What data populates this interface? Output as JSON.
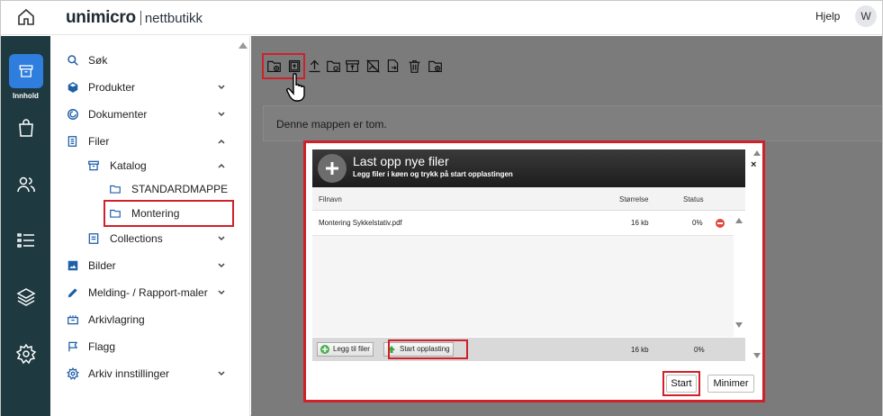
{
  "header": {
    "brand_main": "unimicro",
    "brand_sub": "nettbutikk",
    "help": "Hjelp",
    "avatar_initial": "W"
  },
  "rail": {
    "active_label": "Innhold",
    "icons": [
      "content-icon",
      "bag-icon",
      "users-icon",
      "list-icon",
      "layers-icon",
      "settings-icon"
    ]
  },
  "sidebar": {
    "items": [
      {
        "label": "Søk",
        "icon": "search-icon"
      },
      {
        "label": "Produkter",
        "icon": "box-icon"
      },
      {
        "label": "Dokumenter",
        "icon": "globe-icon"
      },
      {
        "label": "Filer",
        "icon": "files-icon"
      },
      {
        "label": "Katalog",
        "icon": "catalog-icon"
      },
      {
        "label": "STANDARDMAPPE",
        "icon": "folder-icon"
      },
      {
        "label": "Montering",
        "icon": "folder-icon"
      },
      {
        "label": "Collections",
        "icon": "collection-icon"
      },
      {
        "label": "Bilder",
        "icon": "image-icon"
      },
      {
        "label": "Melding- / Rapport-maler",
        "icon": "pen-icon"
      },
      {
        "label": "Arkivlagring",
        "icon": "archive-icon"
      },
      {
        "label": "Flagg",
        "icon": "flag-icon"
      },
      {
        "label": "Arkiv innstillinger",
        "icon": "gear-icon"
      }
    ]
  },
  "main": {
    "empty_message": "Denne mappen er tom."
  },
  "uploader": {
    "title": "Last opp nye filer",
    "subtitle": "Legg filer i køen og trykk på start opplastingen",
    "col_name": "Filnavn",
    "col_size": "Størrelse",
    "col_status": "Status",
    "file_name": "Montering Sykkelstativ.pdf",
    "file_size": "16 kb",
    "file_status": "0%",
    "add_files": "Legg til filer",
    "start_upload": "Start opplasting",
    "total_size": "16 kb",
    "total_status": "0%",
    "close": "×",
    "start_button": "Start",
    "minimize_button": "Minimer"
  },
  "colors": {
    "rail_bg": "#1e3940",
    "accent": "#2f7ddc",
    "highlight": "#d0202a"
  }
}
